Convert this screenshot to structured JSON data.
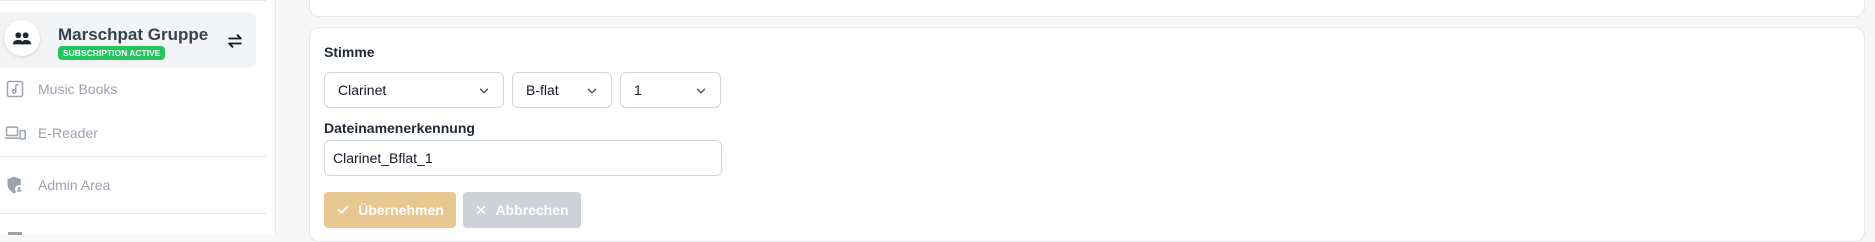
{
  "sidebar": {
    "group": {
      "name": "Marschpat Gruppe",
      "badge": "SUBSCRIPTION ACTIVE",
      "badge_color": "#22c55e"
    },
    "items": [
      {
        "label": "Music Books",
        "icon": "music-note-icon"
      },
      {
        "label": "E-Reader",
        "icon": "laptop-device-icon"
      },
      {
        "label": "Admin Area",
        "icon": "shield-user-icon"
      }
    ]
  },
  "form": {
    "voice_label": "Stimme",
    "instrument": "Clarinet",
    "tuning": "B-flat",
    "voice_number": "1",
    "filename_label": "Dateinamenerkennung",
    "filename_value": "Clarinet_Bflat_1",
    "apply_label": "Übernehmen",
    "cancel_label": "Abbrechen",
    "apply_color": "#e8c890",
    "cancel_color": "#cdd1d8"
  }
}
